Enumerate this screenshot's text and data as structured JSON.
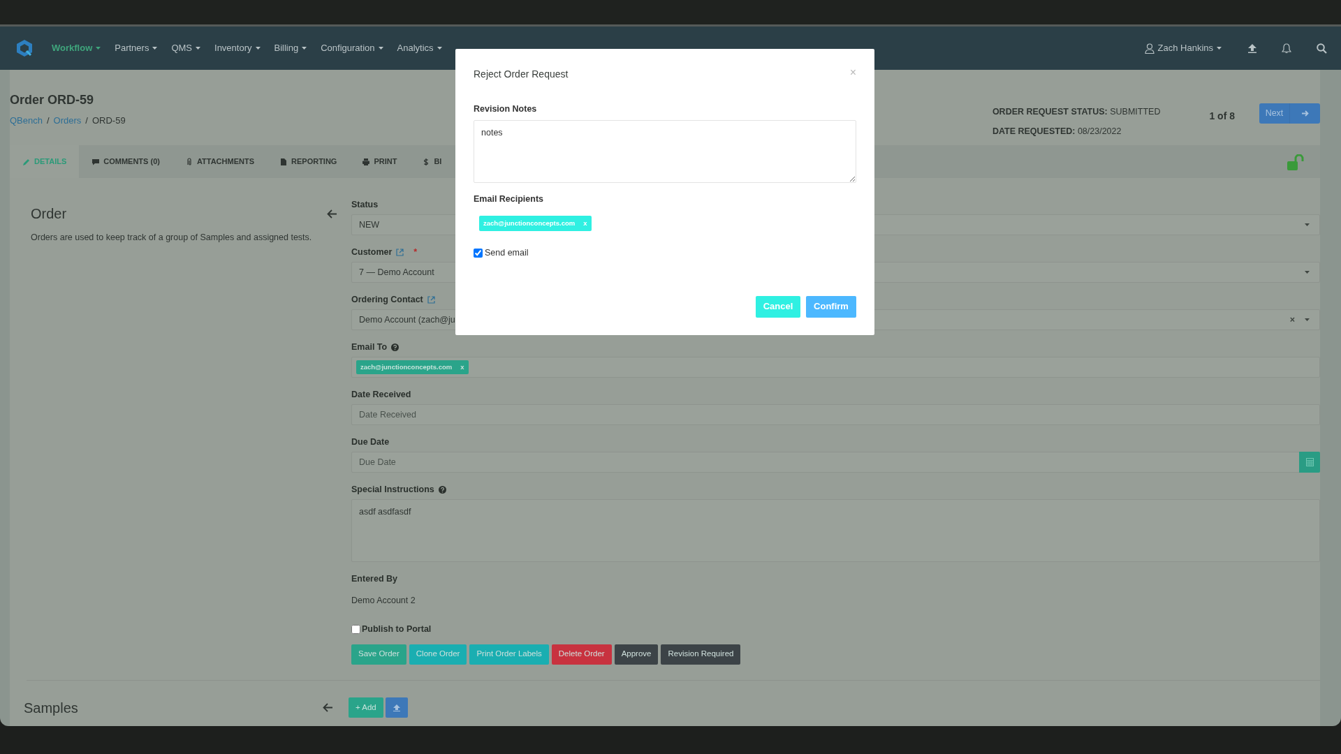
{
  "navbar": {
    "menu": [
      {
        "label": "Workflow",
        "selected": true
      },
      {
        "label": "Partners",
        "selected": false
      },
      {
        "label": "QMS",
        "selected": false
      },
      {
        "label": "Inventory",
        "selected": false
      },
      {
        "label": "Billing",
        "selected": false
      },
      {
        "label": "Configuration",
        "selected": false
      },
      {
        "label": "Analytics",
        "selected": false
      }
    ],
    "user": "Zach Hankins"
  },
  "header": {
    "title": "Order ORD-59",
    "breadcrumb": [
      {
        "label": "QBench",
        "link": true
      },
      {
        "separator": "/",
        "label": "Orders",
        "link": true
      },
      {
        "separator": "/",
        "label": "ORD-59",
        "link": false
      }
    ],
    "status_label": "ORDER REQUEST STATUS:",
    "status_value": "SUBMITTED",
    "date_label": "DATE REQUESTED:",
    "date_value": "08/23/2022",
    "pager": "1 of 8",
    "next_button": "Next",
    "locked": false
  },
  "tabs": [
    {
      "label": "DETAILS",
      "selected": true
    },
    {
      "label": "COMMENTS (0)",
      "selected": false
    },
    {
      "label": "ATTACHMENTS",
      "selected": false
    },
    {
      "label": "REPORTING",
      "selected": false
    },
    {
      "label": "PRINT",
      "selected": false
    },
    {
      "label": "BI",
      "selected": false
    }
  ],
  "order_section": {
    "heading": "Order",
    "description": "Orders are used to keep track of a group of Samples and assigned tests."
  },
  "form": {
    "fields": [
      {
        "kind": "select",
        "label": "Status",
        "value": "NEW",
        "link_icon": false
      },
      {
        "kind": "select",
        "label": "Customer",
        "value": "7 — Demo Account",
        "link_icon": true,
        "required_mark": "*"
      },
      {
        "kind": "select",
        "label": "Ordering Contact",
        "value": "Demo Account (zach@ju",
        "link_icon": true,
        "clear": "×"
      },
      {
        "kind": "tags",
        "label": "Email To",
        "help_icon": true,
        "tags": [
          {
            "text": "zach@junctionconcepts.com",
            "remove": "x"
          }
        ]
      },
      {
        "kind": "input",
        "label": "Date Received",
        "placeholder": "Date Received"
      },
      {
        "kind": "date",
        "label": "Due Date",
        "placeholder": "Due Date"
      },
      {
        "kind": "textarea",
        "label": "Special Instructions",
        "help_icon": true,
        "value": "asdf asdfasdf"
      },
      {
        "kind": "static",
        "label": "Entered By",
        "value": "Demo Account 2"
      },
      {
        "kind": "checkbox",
        "label": "Publish to Portal",
        "checked": false
      }
    ],
    "buttons": [
      {
        "label": "Save Order",
        "color": "#2aa48a"
      },
      {
        "label": "Clone Order",
        "color": "#1aaeb1"
      },
      {
        "label": "Print Order Labels",
        "color": "#1aaeb1"
      },
      {
        "label": "Delete Order",
        "color": "#c8323f"
      },
      {
        "label": "Approve",
        "color": "#3c4347"
      },
      {
        "label": "Revision Required",
        "color": "#3c4347"
      }
    ]
  },
  "samples": {
    "heading": "Samples",
    "add_button": "+ Add"
  },
  "modal": {
    "title": "Reject Order Request",
    "close": "×",
    "notes_label": "Revision Notes",
    "notes_value": "notes",
    "recipients_label": "Email Recipients",
    "recipients": [
      {
        "text": "zach@junctionconcepts.com",
        "remove": "x"
      }
    ],
    "send_email": {
      "label": "Send email",
      "checked": true
    },
    "cancel": "Cancel",
    "confirm": "Confirm"
  }
}
